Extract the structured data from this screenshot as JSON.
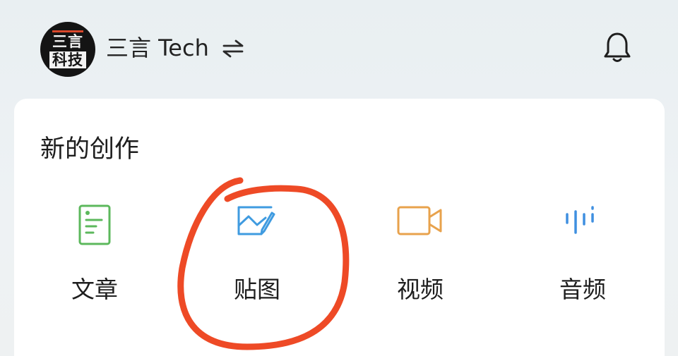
{
  "header": {
    "avatar": {
      "line1": "三言",
      "line2": "科技"
    },
    "account_name": "三言 Tech",
    "switch_icon": "swap-arrows-icon",
    "bell_icon": "bell-icon"
  },
  "create_card": {
    "title": "新的创作",
    "options": [
      {
        "label": "文章",
        "icon": "document-icon",
        "color": "#5cb85c"
      },
      {
        "label": "贴图",
        "icon": "image-icon",
        "color": "#3f9be0"
      },
      {
        "label": "视频",
        "icon": "video-camera-icon",
        "color": "#e8a24c"
      },
      {
        "label": "音频",
        "icon": "audio-wave-icon",
        "color": "#3f8fe0"
      }
    ]
  },
  "annotation_color": "#ee4a26"
}
